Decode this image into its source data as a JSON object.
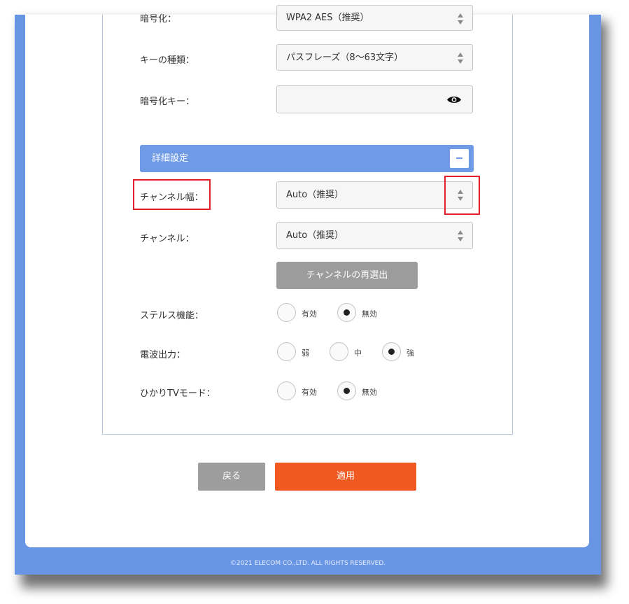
{
  "form": {
    "encryption": {
      "label": "暗号化：",
      "value": "WPA2 AES（推奨）"
    },
    "key_type": {
      "label": "キーの種類：",
      "value": "パスフレーズ（8～63文字）"
    },
    "encryption_key": {
      "label": "暗号化キー：",
      "value": ""
    }
  },
  "advanced": {
    "title": "詳細設定",
    "channel_width": {
      "label": "チャンネル幅：",
      "value": "Auto（推奨）"
    },
    "channel": {
      "label": "チャンネル：",
      "value": "Auto（推奨）"
    },
    "reselect_button": "チャンネルの再選出",
    "stealth": {
      "label": "ステルス機能：",
      "options": [
        "有効",
        "無効"
      ],
      "selected": "無効"
    },
    "tx_power": {
      "label": "電波出力：",
      "options": [
        "弱",
        "中",
        "強"
      ],
      "selected": "強"
    },
    "hikari_tv": {
      "label": "ひかりTVモード：",
      "options": [
        "有効",
        "無効"
      ],
      "selected": "無効"
    }
  },
  "actions": {
    "back": "戻る",
    "apply": "適用"
  },
  "footer": "©2021 ELECOM CO.,LTD. ALL RIGHTS RESERVED.",
  "colors": {
    "frame": "#6995e5",
    "section_bar": "#6e9ae6",
    "apply": "#f05a22",
    "secondary_button": "#9c9c9c",
    "highlight": "#e0202a"
  }
}
